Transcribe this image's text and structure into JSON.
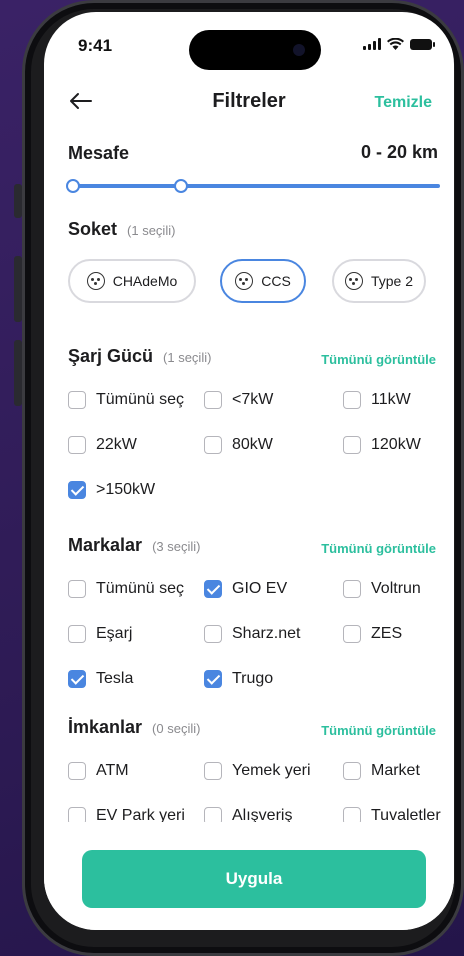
{
  "status": {
    "time": "9:41"
  },
  "header": {
    "title": "Filtreler",
    "clear_label": "Temizle"
  },
  "distance": {
    "label": "Mesafe",
    "range_text": "0 - 20 km",
    "min_km": 0,
    "max_km": 20
  },
  "socket": {
    "label": "Soket",
    "count": "(1 seçili)",
    "chips": [
      {
        "label": "CHAdeMo",
        "selected": false
      },
      {
        "label": "CCS",
        "selected": true
      },
      {
        "label": "Type 2",
        "selected": false
      }
    ]
  },
  "power": {
    "label": "Şarj Gücü",
    "count": "(1 seçili)",
    "view_all": "Tümünü görüntüle",
    "options": [
      {
        "label": "Tümünü seç",
        "checked": false
      },
      {
        "label": "<7kW",
        "checked": false
      },
      {
        "label": "11kW",
        "checked": false
      },
      {
        "label": "22kW",
        "checked": false
      },
      {
        "label": "80kW",
        "checked": false
      },
      {
        "label": "120kW",
        "checked": false
      },
      {
        "label": ">150kW",
        "checked": true
      }
    ]
  },
  "brands": {
    "label": "Markalar",
    "count": "(3 seçili)",
    "view_all": "Tümünü görüntüle",
    "options": [
      {
        "label": "Tümünü seç",
        "checked": false
      },
      {
        "label": "GIO EV",
        "checked": true
      },
      {
        "label": "Voltrun",
        "checked": false
      },
      {
        "label": "Eşarj",
        "checked": false
      },
      {
        "label": "Sharz.net",
        "checked": false
      },
      {
        "label": "ZES",
        "checked": false
      },
      {
        "label": "Tesla",
        "checked": true
      },
      {
        "label": "Trugo",
        "checked": true
      }
    ]
  },
  "amenities": {
    "label": "İmkanlar",
    "count": "(0 seçili)",
    "view_all": "Tümünü görüntüle",
    "options": [
      {
        "label": "ATM",
        "checked": false
      },
      {
        "label": "Yemek yeri",
        "checked": false
      },
      {
        "label": "Market",
        "checked": false
      },
      {
        "label": "EV Park yeri",
        "checked": false
      },
      {
        "label": "Alışveriş",
        "checked": false
      },
      {
        "label": "Tuvaletler",
        "checked": false
      }
    ]
  },
  "footer": {
    "apply_label": "Uygula"
  },
  "colors": {
    "accent_green": "#2cbf9e",
    "accent_blue": "#4a86e0"
  }
}
